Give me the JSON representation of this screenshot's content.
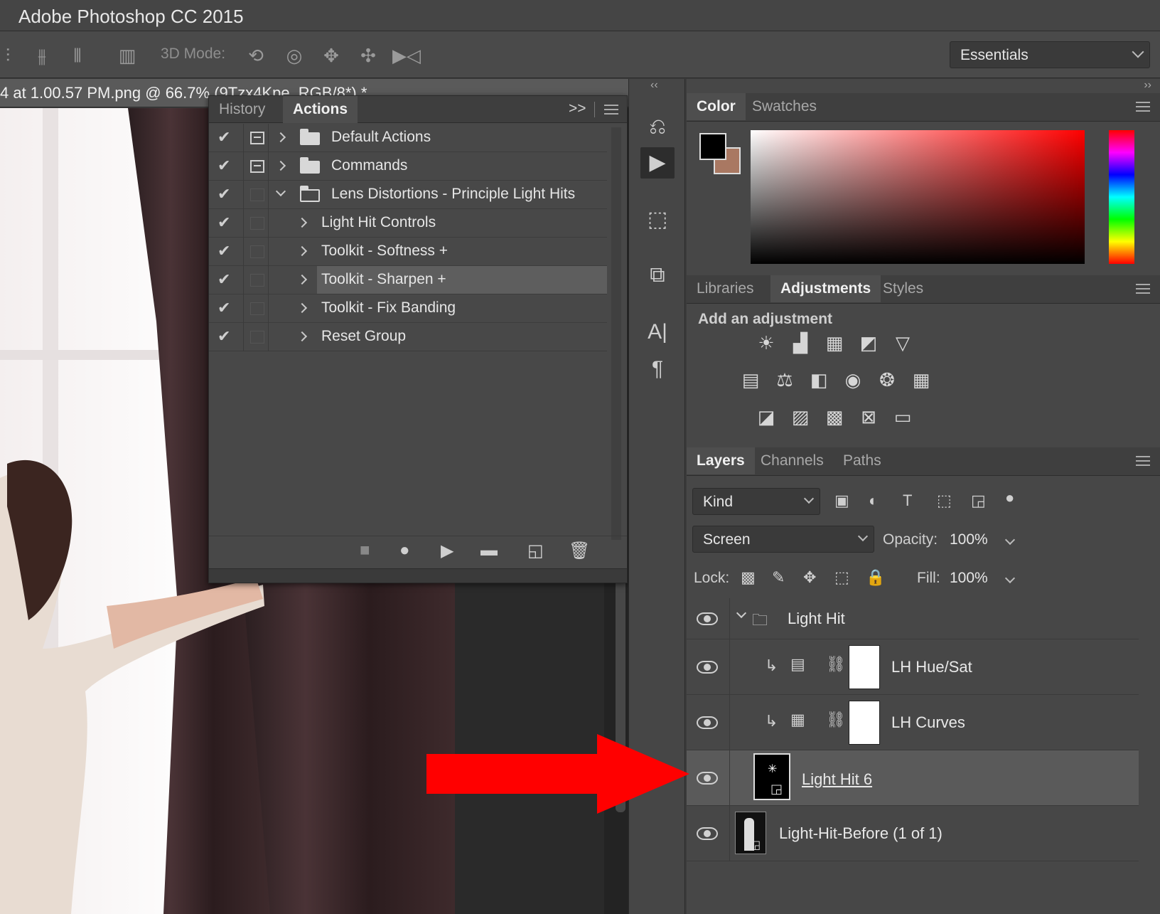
{
  "app": {
    "title": "Adobe Photoshop CC 2015"
  },
  "options_bar": {
    "mode_label": "3D Mode:",
    "workspace": "Essentials"
  },
  "document": {
    "tab_title": "4 at 1.00.57 PM.png @ 66.7% (9Tzx4Kpe, RGB/8*) *"
  },
  "actions_panel": {
    "tabs": [
      "History",
      "Actions"
    ],
    "active_tab": "Actions",
    "expand_glyph": ">>",
    "items": [
      {
        "label": "Default Actions",
        "type": "set",
        "expanded": false
      },
      {
        "label": "Commands",
        "type": "set",
        "expanded": false
      },
      {
        "label": "Lens Distortions - Principle Light Hits",
        "type": "set",
        "expanded": true
      },
      {
        "label": "Light Hit Controls",
        "type": "action"
      },
      {
        "label": "Toolkit - Softness +",
        "type": "action"
      },
      {
        "label": "Toolkit - Sharpen +",
        "type": "action",
        "selected": true
      },
      {
        "label": "Toolkit - Fix Banding",
        "type": "action"
      },
      {
        "label": "Reset Group",
        "type": "action"
      }
    ]
  },
  "color_panel": {
    "tabs": [
      "Color",
      "Swatches"
    ],
    "active_tab": "Color",
    "foreground": "#000000",
    "background": "#a97862"
  },
  "adjustments_panel": {
    "tabs": [
      "Libraries",
      "Adjustments",
      "Styles"
    ],
    "active_tab": "Adjustments",
    "title": "Add an adjustment"
  },
  "layers_panel": {
    "tabs": [
      "Layers",
      "Channels",
      "Paths"
    ],
    "active_tab": "Layers",
    "filter": "Kind",
    "blend_mode": "Screen",
    "opacity_label": "Opacity:",
    "opacity": "100%",
    "lock_label": "Lock:",
    "fill_label": "Fill:",
    "fill": "100%",
    "layers": [
      {
        "name": "Light Hit",
        "type": "group"
      },
      {
        "name": "LH Hue/Sat",
        "type": "adjustment"
      },
      {
        "name": "LH Curves",
        "type": "adjustment"
      },
      {
        "name": "Light Hit 6",
        "type": "smart-object",
        "selected": true
      },
      {
        "name": "Light-Hit-Before (1 of 1)",
        "type": "smart-object"
      }
    ]
  },
  "annotation": {
    "arrow_color": "#ff0000"
  }
}
